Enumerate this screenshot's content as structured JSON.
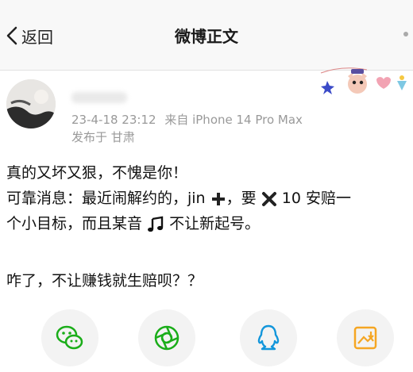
{
  "nav": {
    "back_label": "返回",
    "title": "微博正文"
  },
  "post": {
    "time": "23-4-18 23:12",
    "source": "来自 iPhone 14 Pro Max",
    "location": "发布于 甘肃",
    "lines": {
      "l1": "真的又坏又狠，不愧是你！",
      "l2a": "可靠消息：最近闹解约的，jin",
      "l2b": "，要",
      "l2c": "10 安赔一",
      "l3a": "个小目标，而且某音",
      "l3b": "不让新起号。",
      "l4": "咋了，不让赚钱就生赔呗？？"
    }
  },
  "share": [
    "wechat-icon",
    "moments-icon",
    "qq-icon",
    "save-image-icon"
  ],
  "colors": {
    "green": "#1aad19",
    "blue": "#1296db",
    "orange": "#f5a623",
    "grey_text": "#999999"
  }
}
